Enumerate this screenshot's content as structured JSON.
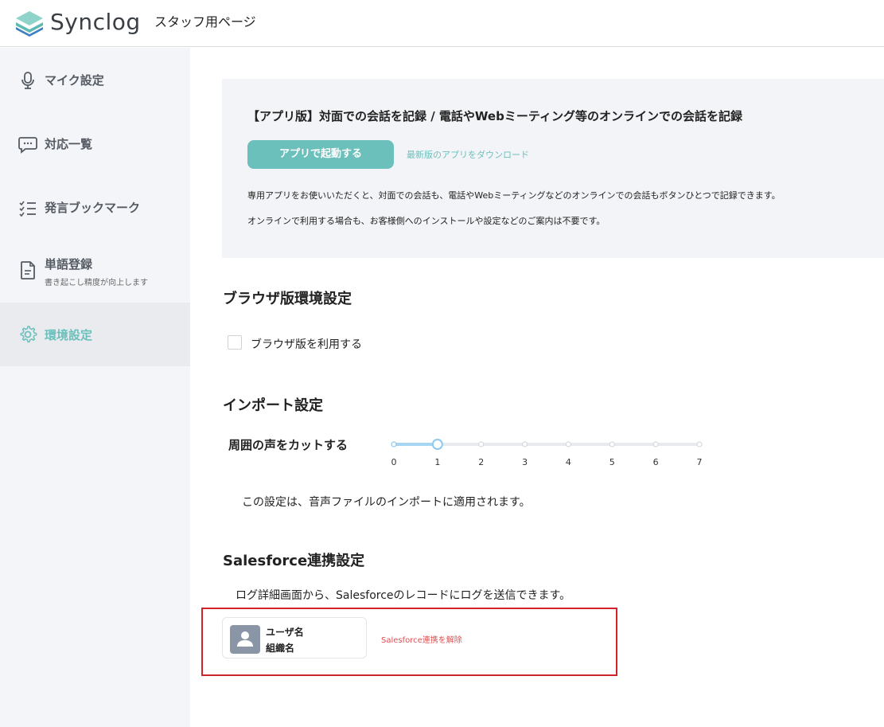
{
  "header": {
    "logo_text": "Synclog",
    "page_title": "スタッフ用ページ"
  },
  "sidebar": {
    "items": [
      {
        "label": "マイク設定",
        "icon": "microphone-icon"
      },
      {
        "label": "対応一覧",
        "icon": "chat-bubble-icon"
      },
      {
        "label": "発言ブックマーク",
        "icon": "checklist-icon"
      },
      {
        "label": "単語登録",
        "sublabel": "書き起こし精度が向上します",
        "icon": "document-icon"
      },
      {
        "label": "環境設定",
        "icon": "gear-icon",
        "active": true
      }
    ]
  },
  "app_panel": {
    "title": "【アプリ版】対面での会話を記録 / 電話やWebミーティング等のオンラインでの会話を記録",
    "launch_button": "アプリで起動する",
    "download_link": "最新版のアプリをダウンロード",
    "desc1": "専用アプリをお使いいただくと、対面での会話も、電話やWebミーティングなどのオンラインでの会話もボタンひとつで記録できます。",
    "desc2": "オンラインで利用する場合も、お客様側へのインストールや設定などのご案内は不要です。"
  },
  "browser_section": {
    "title": "ブラウザ版環境設定",
    "checkbox_label": "ブラウザ版を利用する",
    "checked": false
  },
  "import_section": {
    "title": "インポート設定",
    "slider_label": "周囲の声をカットする",
    "slider_ticks": [
      "0",
      "1",
      "2",
      "3",
      "4",
      "5",
      "6",
      "7"
    ],
    "slider_value": 1,
    "note": "この設定は、音声ファイルのインポートに適用されます。"
  },
  "salesforce_section": {
    "title": "Salesforce連携設定",
    "desc": "ログ詳細画面から、Salesforceのレコードにログを送信できます。",
    "user_name": "ユーザ名",
    "org_name": "組織名",
    "unlink": "Salesforce連携を解除"
  },
  "colors": {
    "accent": "#6cc0bc",
    "danger": "#e05050",
    "highlight": "#d3232a"
  }
}
